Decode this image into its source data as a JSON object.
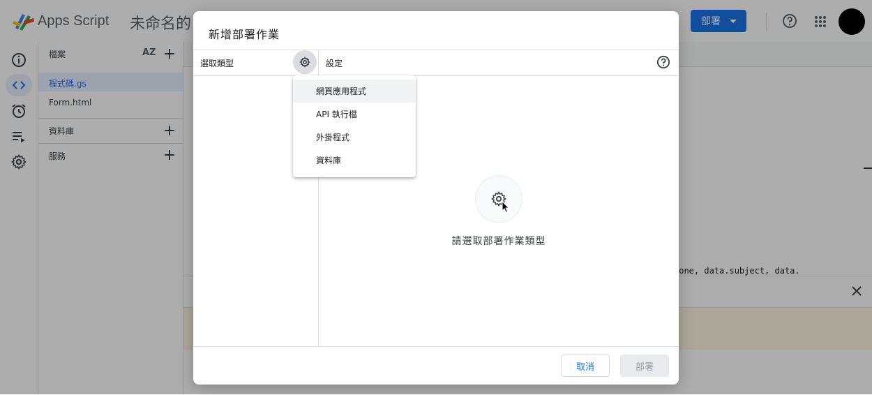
{
  "app": {
    "name": "Apps Script",
    "project_title": "未命名的",
    "deploy_button": "部署"
  },
  "files": {
    "header": "檔案",
    "sort_icon_text": "AZ",
    "items": [
      {
        "name": "程式碼.gs",
        "active": true
      },
      {
        "name": "Form.html",
        "active": false
      }
    ],
    "sections": [
      {
        "label": "資料庫"
      },
      {
        "label": "服務"
      }
    ]
  },
  "editor": {
    "code_snippet": "hone, data.subject, data."
  },
  "dialog": {
    "title": "新增部署作業",
    "left_header": "選取類型",
    "right_header": "設定",
    "empty_message": "請選取部署作業類型",
    "cancel_button": "取消",
    "deploy_button": "部署"
  },
  "menu": {
    "items": [
      {
        "label": "網頁應用程式",
        "hover": true
      },
      {
        "label": "API 執行檔",
        "hover": false
      },
      {
        "label": "外掛程式",
        "hover": false
      },
      {
        "label": "資料庫",
        "hover": false
      }
    ]
  },
  "colors": {
    "accent": "#1a73e8",
    "scrim": "#000000",
    "avatar": "#000000"
  },
  "icons": [
    "apps-script-logo",
    "help-icon",
    "apps-grid-icon",
    "info-icon",
    "code-icon",
    "clock-icon",
    "executions-icon",
    "settings-icon",
    "gear-icon",
    "close-icon",
    "cursor-icon"
  ]
}
